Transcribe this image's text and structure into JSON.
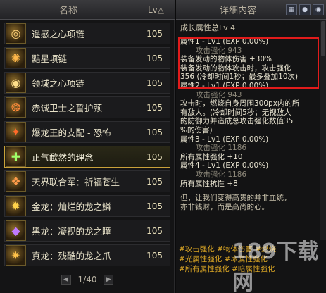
{
  "list_header": {
    "name_col": "名称",
    "lv_col": "Lv△"
  },
  "items": [
    {
      "name": "遥感之心项链",
      "lv": "105",
      "glyph": "◎",
      "icon": "necklace-icon",
      "color": "#ffd27a",
      "selected": false
    },
    {
      "name": "黯星项链",
      "lv": "105",
      "glyph": "✺",
      "icon": "dark-star-necklace-icon",
      "color": "#ffb84a",
      "selected": false
    },
    {
      "name": "领域之心项链",
      "lv": "105",
      "glyph": "◉",
      "icon": "domain-necklace-icon",
      "color": "#ffe08a",
      "selected": false
    },
    {
      "name": "赤诚卫士之誓护颈",
      "lv": "105",
      "glyph": "❂",
      "icon": "guard-neck-icon",
      "color": "#ff8a3a",
      "selected": false
    },
    {
      "name": "爆龙王的支配 - 恐怖",
      "lv": "105",
      "glyph": "✦",
      "icon": "dragon-king-icon",
      "color": "#ff6a2a",
      "selected": false
    },
    {
      "name": "正气歃然的理念",
      "lv": "105",
      "glyph": "✚",
      "icon": "justice-icon",
      "color": "#9fff6a",
      "selected": true
    },
    {
      "name": "天界联合军：祈福苍生",
      "lv": "105",
      "glyph": "❖",
      "icon": "celestial-army-icon",
      "color": "#ff9a4a",
      "selected": false
    },
    {
      "name": "金龙：灿烂的龙之鳞",
      "lv": "105",
      "glyph": "✹",
      "icon": "golden-dragon-icon",
      "color": "#ffd24a",
      "selected": false
    },
    {
      "name": "黑龙：凝视的龙之瞳",
      "lv": "105",
      "glyph": "◆",
      "icon": "black-dragon-icon",
      "color": "#c07aff",
      "selected": false
    },
    {
      "name": "真龙：残酷的龙之爪",
      "lv": "105",
      "glyph": "✷",
      "icon": "true-dragon-icon",
      "color": "#ffc24a",
      "selected": false
    }
  ],
  "pagination": {
    "text": "1/40"
  },
  "detail": {
    "title": "详细内容",
    "header": "成长属性总Lv 4",
    "attrs": [
      {
        "title": "属性1 - Lv1 (EXP 0.00%)",
        "lines": [
          {
            "t": "攻击强化 943",
            "c": "gray",
            "ind": true
          },
          {
            "t": "装备发动的物体伤害 +30%",
            "c": "white",
            "ind": false
          },
          {
            "t": "装备发动的物体攻击时，攻击强化",
            "c": "white",
            "ind": false
          },
          {
            "t": "356 (冷却时间1秒；最多叠加10次)",
            "c": "white",
            "ind": false
          }
        ]
      },
      {
        "title": "属性2 - Lv1 (EXP 0.00%)",
        "lines": [
          {
            "t": "攻击强化 943",
            "c": "gray",
            "ind": true
          },
          {
            "t": "攻击时，燃烧自身周围300px内的所",
            "c": "white",
            "ind": false
          },
          {
            "t": "有敌人。(冷却时间5秒；无视敌人",
            "c": "white",
            "ind": false
          },
          {
            "t": "的防御力并造成总攻击强化数值35",
            "c": "white",
            "ind": false
          },
          {
            "t": "%的伤害)",
            "c": "white",
            "ind": false
          }
        ]
      },
      {
        "title": "属性3 - Lv1 (EXP 0.00%)",
        "lines": [
          {
            "t": "攻击强化 1186",
            "c": "gray",
            "ind": true
          },
          {
            "t": "所有属性强化 +10",
            "c": "white",
            "ind": false
          }
        ]
      },
      {
        "title": "属性4 - Lv1 (EXP 0.00%)",
        "lines": [
          {
            "t": "攻击强化 1186",
            "c": "gray",
            "ind": true
          },
          {
            "t": "所有属性抗性 +8",
            "c": "white",
            "ind": false
          }
        ]
      }
    ],
    "quote": [
      "但，让我们变得高贵的并非血统，",
      "亦非钱财，而是高尚的心。"
    ],
    "tags": [
      "#攻击强化 #物体伤害 #燃烧",
      "#光属性强化 #冰属性强化",
      "#所有属性强化 #暗属性强化"
    ]
  },
  "watermark": "189下载网"
}
